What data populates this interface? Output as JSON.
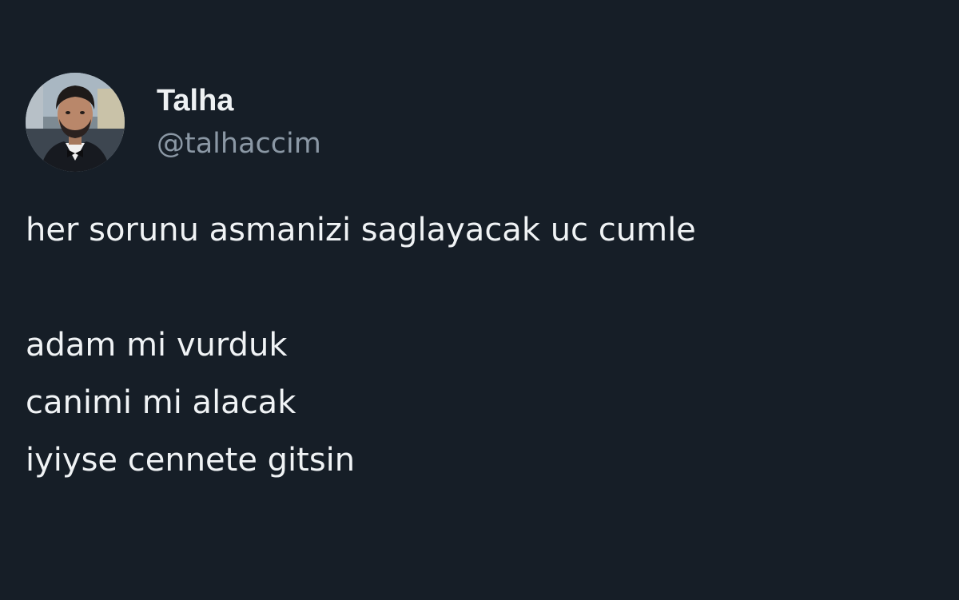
{
  "author": {
    "display_name": "Talha",
    "handle": "@talhaccim",
    "avatar_icon": "profile-photo-icon"
  },
  "tweet": {
    "lines": [
      "her sorunu asmanizi saglayacak uc cumle",
      "",
      "adam mi vurduk",
      "canimi mi alacak",
      "iyiyse cennete gitsin"
    ]
  },
  "colors": {
    "background": "#161e27",
    "text": "#f0f3f5",
    "secondary_text": "#8b98a5"
  }
}
